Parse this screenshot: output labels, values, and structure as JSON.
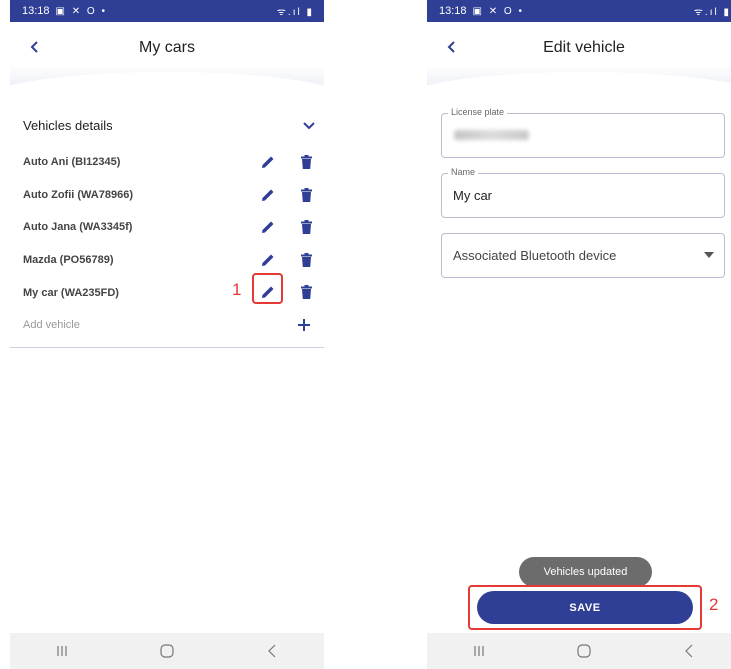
{
  "status_bar": {
    "time": "13:18",
    "left_icons": "▣ ✕ O •",
    "right_icons": "ᯤ.ıl ▮"
  },
  "screens": {
    "my_cars": {
      "title": "My cars",
      "section_label": "Vehicles details",
      "vehicles": [
        {
          "label": "Auto Ani (BI12345)"
        },
        {
          "label": "Auto Zofii (WA78966)"
        },
        {
          "label": "Auto Jana (WA3345f)"
        },
        {
          "label": "Mazda (PO56789)"
        },
        {
          "label": "My car (WA235FD)"
        }
      ],
      "add_vehicle_label": "Add vehicle"
    },
    "edit_vehicle": {
      "title": "Edit vehicle",
      "license_plate": {
        "label": "License plate",
        "value": ""
      },
      "name": {
        "label": "Name",
        "value": "My car"
      },
      "bluetooth_select": {
        "label": "Associated Bluetooth device"
      },
      "toast": "Vehicles updated",
      "save_label": "SAVE"
    }
  },
  "navigation_bar": {
    "recents": "|||",
    "home": "○",
    "back": "<"
  },
  "annotations": [
    {
      "number": "1"
    },
    {
      "number": "2"
    }
  ],
  "colors": {
    "brand": "#2f3f95",
    "callout": "#e53935",
    "toast": "#6c6c6c"
  },
  "icons": [
    "back-icon",
    "chevron-down-icon",
    "pencil-icon",
    "trash-icon",
    "plus-icon",
    "dropdown-arrow-icon"
  ]
}
